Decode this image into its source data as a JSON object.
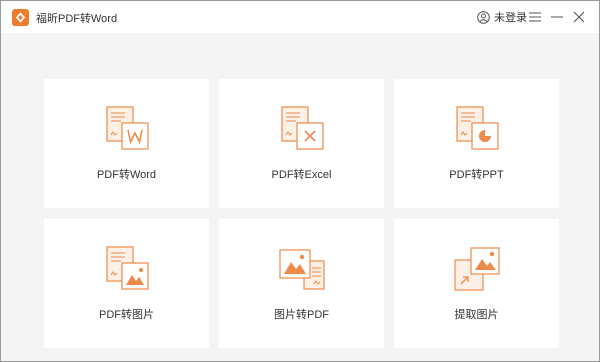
{
  "app": {
    "title": "福昕PDF转Word",
    "accent_color": "#ee8a4a"
  },
  "header": {
    "login_label": "未登录",
    "login_icon": "user-icon",
    "menu_icon": "hamburger-menu-icon",
    "minimize_icon": "minimize-icon",
    "close_icon": "close-icon"
  },
  "tools": [
    {
      "label": "PDF转Word",
      "icon": "pdf-to-word-icon"
    },
    {
      "label": "PDF转Excel",
      "icon": "pdf-to-excel-icon"
    },
    {
      "label": "PDF转PPT",
      "icon": "pdf-to-ppt-icon"
    },
    {
      "label": "PDF转图片",
      "icon": "pdf-to-image-icon"
    },
    {
      "label": "图片转PDF",
      "icon": "image-to-pdf-icon"
    },
    {
      "label": "提取图片",
      "icon": "extract-image-icon"
    }
  ]
}
